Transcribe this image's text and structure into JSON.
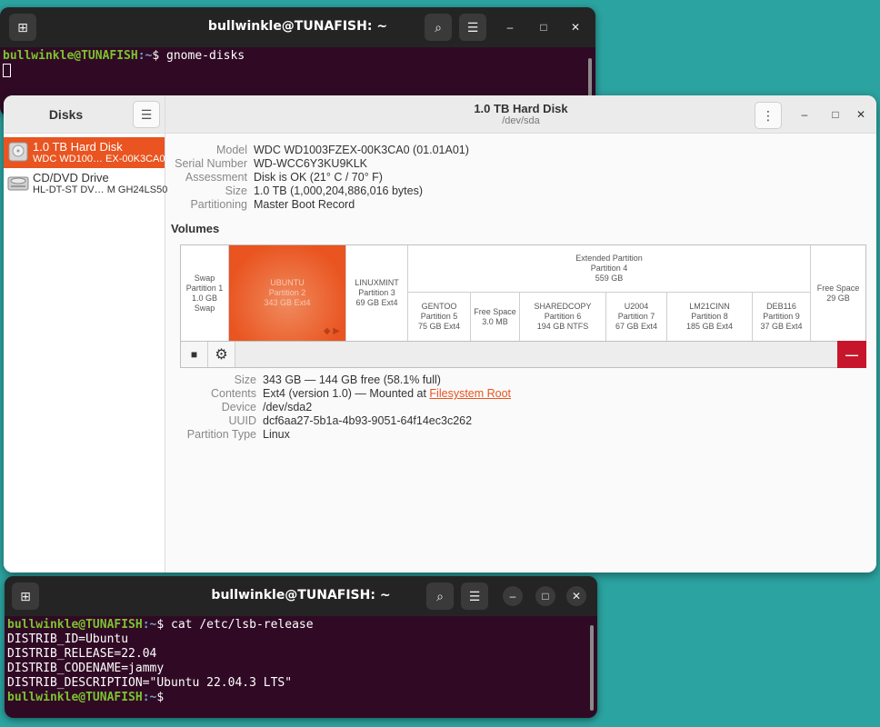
{
  "top_terminal": {
    "title": "bullwinkle@TUNAFISH: ~",
    "user_host": "bullwinkle@TUNAFISH",
    "path": ":~",
    "command": "$ gnome-disks",
    "new_tab_icon": "new-tab-icon",
    "search_icon": "search-icon",
    "menu_icon": "hamburger-menu-icon",
    "minimize": "–",
    "maximize": "□",
    "close": "✕"
  },
  "disks": {
    "sidebar": {
      "title": "Disks",
      "items": [
        {
          "name": "1.0 TB Hard Disk",
          "model": "WDC WD100…  EX-00K3CA0",
          "selected": true
        },
        {
          "name": "CD/DVD Drive",
          "model": "HL-DT-ST DV…  M GH24LS50",
          "selected": false
        }
      ]
    },
    "header": {
      "title": "1.0 TB Hard Disk",
      "subtitle": "/dev/sda"
    },
    "disk_info": [
      {
        "key": "Model",
        "value": "WDC WD1003FZEX-00K3CA0 (01.01A01)"
      },
      {
        "key": "Serial Number",
        "value": "WD-WCC6Y3KU9KLK"
      },
      {
        "key": "Assessment",
        "value": "Disk is OK (21° C / 70° F)"
      },
      {
        "key": "Size",
        "value": "1.0 TB (1,000,204,886,016 bytes)"
      },
      {
        "key": "Partitioning",
        "value": "Master Boot Record"
      }
    ],
    "volumes_label": "Volumes",
    "volumes": {
      "swap": {
        "name": "Swap",
        "part": "Partition 1",
        "size": "1.0 GB Swap"
      },
      "ubuntu": {
        "name": "UBUNTU",
        "part": "Partition 2",
        "size": "343 GB Ext4"
      },
      "linuxmint": {
        "name": "LINUXMINT",
        "part": "Partition 3",
        "size": "69 GB Ext4"
      },
      "extended": {
        "name": "Extended Partition",
        "part": "Partition 4",
        "size": "559 GB"
      },
      "gentoo": {
        "name": "GENTOO",
        "part": "Partition 5",
        "size": "75 GB Ext4"
      },
      "free1": {
        "name": "Free Space",
        "size": "3.0 MB"
      },
      "sharedcopy": {
        "name": "SHAREDCOPY",
        "part": "Partition 6",
        "size": "194 GB NTFS"
      },
      "u2004": {
        "name": "U2004",
        "part": "Partition 7",
        "size": "67 GB Ext4"
      },
      "lm21": {
        "name": "LM21CINN",
        "part": "Partition 8",
        "size": "185 GB Ext4"
      },
      "deb116": {
        "name": "DEB116",
        "part": "Partition 9",
        "size": "37 GB Ext4"
      },
      "free2": {
        "name": "Free Space",
        "size": "29 GB"
      }
    },
    "volume_toolbar": {
      "stop": "■",
      "gear": "⚙",
      "delete": "—"
    },
    "volume_info": [
      {
        "key": "Size",
        "value": "343 GB — 144 GB free (58.1% full)"
      },
      {
        "key": "Contents",
        "value": "Ext4 (version 1.0) — Mounted at ",
        "link": "Filesystem Root"
      },
      {
        "key": "Device",
        "value": "/dev/sda2"
      },
      {
        "key": "UUID",
        "value": "dcf6aa27-5b1a-4b93-9051-64f14ec3c262"
      },
      {
        "key": "Partition Type",
        "value": "Linux"
      }
    ]
  },
  "bottom_terminal": {
    "title": "bullwinkle@TUNAFISH: ~",
    "user_host": "bullwinkle@TUNAFISH",
    "path": ":~",
    "command": "$ cat /etc/lsb-release",
    "lines": [
      "DISTRIB_ID=Ubuntu",
      "DISTRIB_RELEASE=22.04",
      "DISTRIB_CODENAME=jammy",
      "DISTRIB_DESCRIPTION=\"Ubuntu 22.04.3 LTS\""
    ],
    "end_prompt": "$"
  },
  "colors": {
    "desktop": "#2ba3a0",
    "terminal_bg": "#300a24",
    "accent": "#e95420",
    "danger": "#c7162b"
  }
}
